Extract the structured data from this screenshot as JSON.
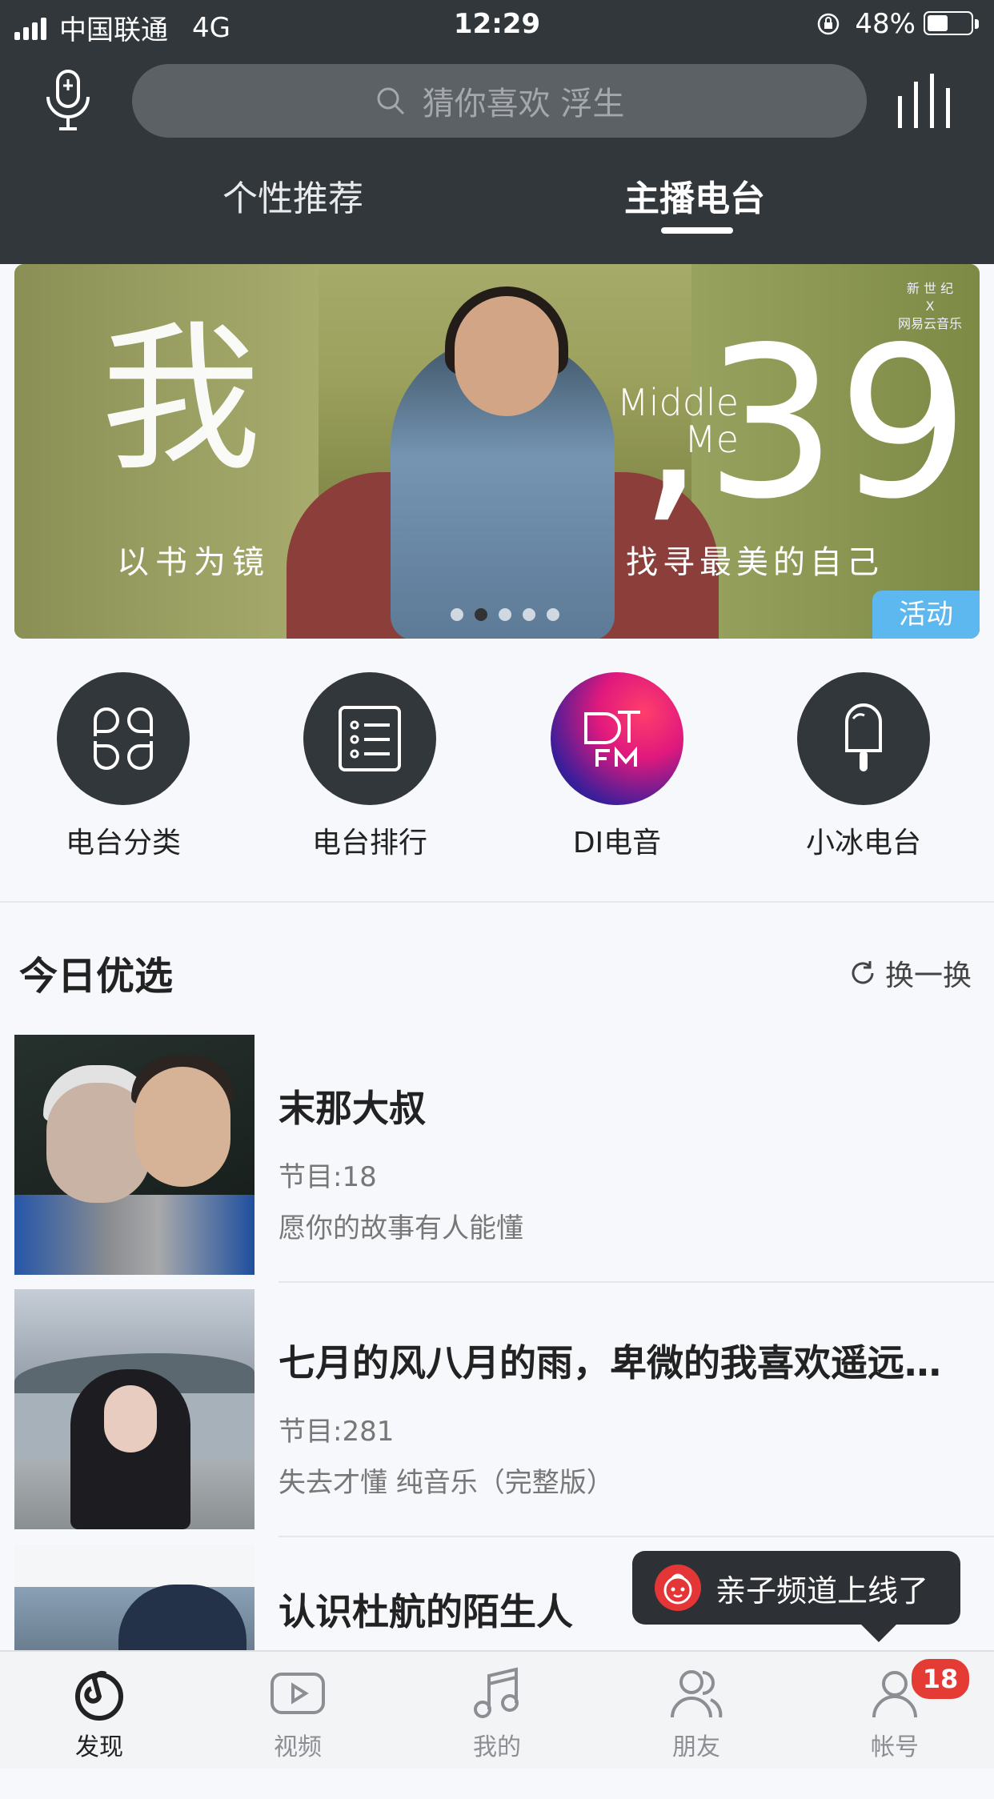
{
  "status_bar": {
    "carrier": "中国联通",
    "network": "4G",
    "time": "12:29",
    "battery": "48%",
    "battery_level": 0.48
  },
  "search": {
    "placeholder": "猜你喜欢 浮生"
  },
  "tabs": [
    {
      "label": "个性推荐",
      "active": false
    },
    {
      "label": "主播电台",
      "active": true
    }
  ],
  "banner": {
    "big_char": "我",
    "left_sub": "以书为镜",
    "middle": "Middle",
    "me": "Me",
    "number": ",39",
    "right_sub": "找寻最美的自己",
    "brand_line1": "新 世 纪",
    "brand_line2": "X",
    "brand_line3": "网易云音乐",
    "tag": "活动",
    "pages": 5,
    "current_page": 2
  },
  "entries": [
    {
      "label": "电台分类",
      "icon": "category-grid-icon"
    },
    {
      "label": "电台排行",
      "icon": "ranking-list-icon"
    },
    {
      "label": "DI电音",
      "icon": "di-fm-icon"
    },
    {
      "label": "小冰电台",
      "icon": "popsicle-icon"
    }
  ],
  "today": {
    "title": "今日优选",
    "refresh": "换一换",
    "items": [
      {
        "title": "末那大叔",
        "count": "节目:18",
        "desc": "愿你的故事有人能懂"
      },
      {
        "title": "七月的风八月的雨，卑微的我喜欢遥远…",
        "count": "节目:281",
        "desc": "失去才懂 纯音乐（完整版）"
      },
      {
        "title": "认识杜航的陌生人"
      }
    ]
  },
  "toast": {
    "text": "亲子频道上线了"
  },
  "tabbar": [
    {
      "label": "发现",
      "icon": "discover-icon",
      "active": true
    },
    {
      "label": "视频",
      "icon": "video-icon",
      "active": false
    },
    {
      "label": "我的",
      "icon": "music-note-icon",
      "active": false
    },
    {
      "label": "朋友",
      "icon": "friends-icon",
      "active": false
    },
    {
      "label": "帐号",
      "icon": "account-icon",
      "active": false,
      "badge": "18"
    }
  ],
  "colors": {
    "header_bg": "#32373b",
    "accent_blue": "#5db8ef",
    "badge_red": "#e53b35"
  }
}
